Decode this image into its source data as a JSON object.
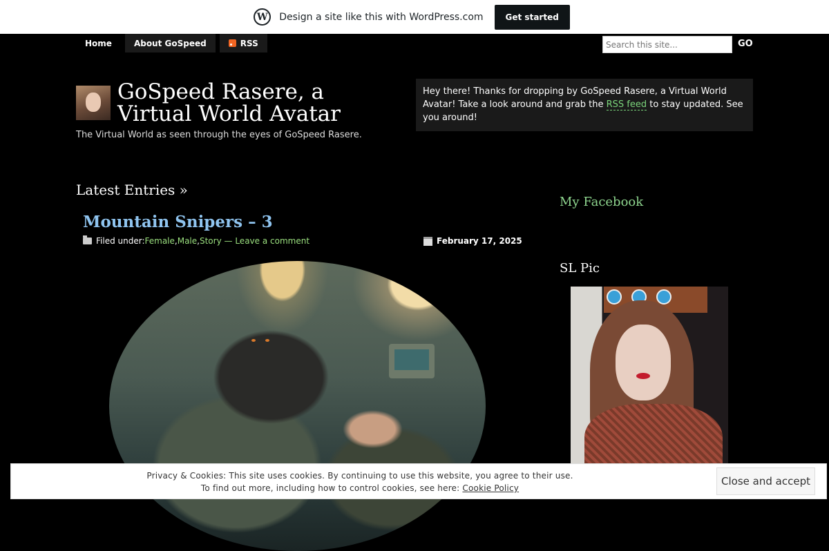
{
  "wp_banner": {
    "text": "Design a site like this with WordPress.com",
    "cta": "Get started"
  },
  "nav": {
    "items": [
      {
        "label": "Home"
      },
      {
        "label": "About GoSpeed"
      },
      {
        "label": "RSS"
      }
    ]
  },
  "search": {
    "placeholder": "Search this site...",
    "button": "GO"
  },
  "header": {
    "title": "GoSpeed Rasere, a Virtual World Avatar",
    "tagline": "The Virtual World as seen through the eyes of GoSpeed Rasere."
  },
  "welcome": {
    "before": "Hey there! Thanks for dropping by GoSpeed Rasere, a Virtual World Avatar! Take a look around and grab the ",
    "link": "RSS feed",
    "after": " to stay updated. See you around!"
  },
  "main": {
    "section_title": "Latest Entries »",
    "post": {
      "title": "Mountain Snipers – 3",
      "filed_under": "Filed under: ",
      "categories": [
        "Female",
        "Male",
        "Story"
      ],
      "sep": ", ",
      "comment_link": "— Leave a comment",
      "date": "February 17, 2025"
    }
  },
  "sidebar": {
    "facebook_title": "My Facebook",
    "slpic_title": "SL Pic"
  },
  "cookie": {
    "line1": "Privacy & Cookies: This site uses cookies. By continuing to use this website, you agree to their use.",
    "line2_prefix": "To find out more, including how to control cookies, see here: ",
    "policy_link": "Cookie Policy",
    "button": "Close and accept"
  },
  "colors": {
    "background": "#000000",
    "link_green": "#9be07f",
    "post_title_blue": "#8fc4ef",
    "widget_title_green": "#8fd68f"
  }
}
